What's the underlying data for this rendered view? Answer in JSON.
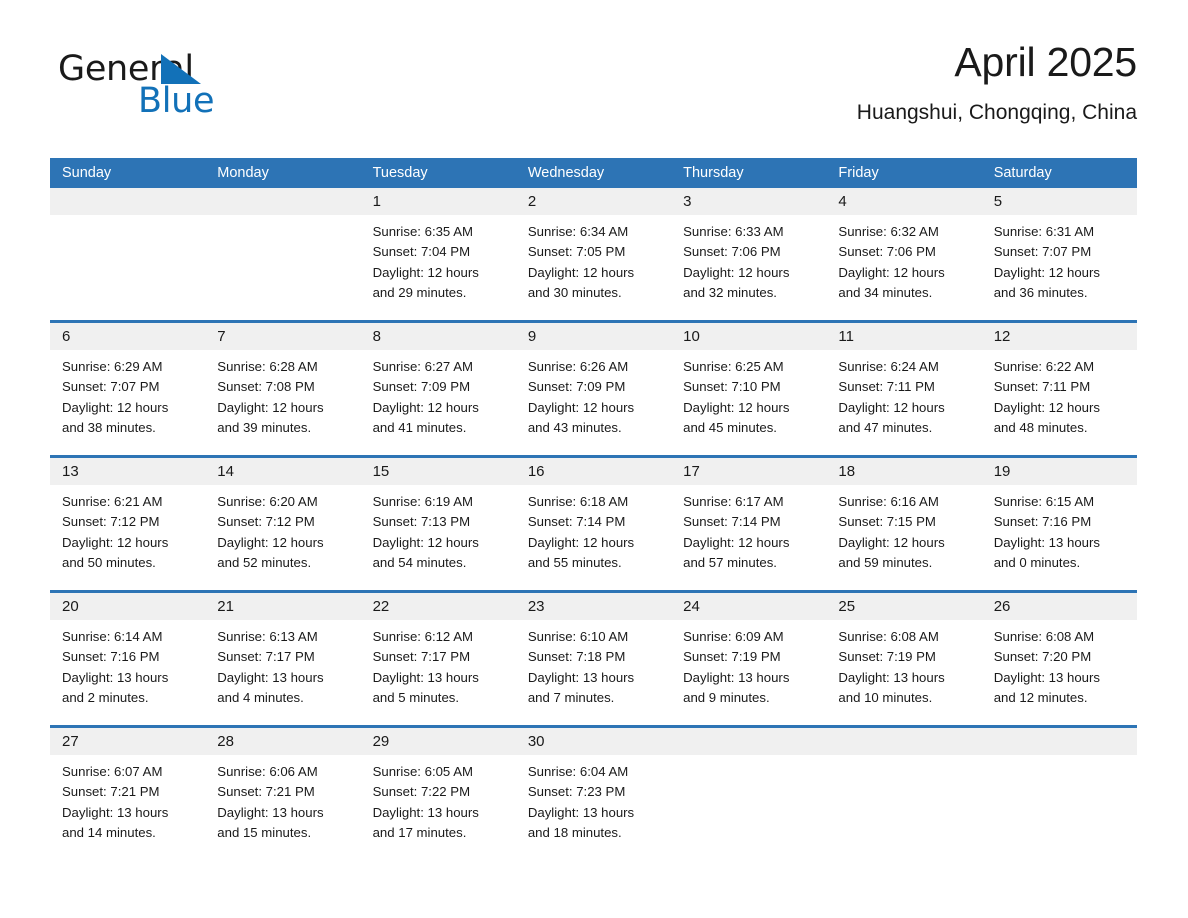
{
  "brand": {
    "name_part1": "General",
    "name_part2": "Blue",
    "triangle_icon": "blue-triangle-icon",
    "colors": {
      "black": "#1a1a1a",
      "blue": "#1271b8"
    }
  },
  "header": {
    "month_title": "April 2025",
    "location": "Huangshui, Chongqing, China"
  },
  "calendar": {
    "accent_color": "#2d74b5",
    "day_band_color": "#f0f0f0",
    "weekdays": [
      "Sunday",
      "Monday",
      "Tuesday",
      "Wednesday",
      "Thursday",
      "Friday",
      "Saturday"
    ],
    "weeks": [
      [
        {
          "day": "",
          "lines": []
        },
        {
          "day": "",
          "lines": []
        },
        {
          "day": "1",
          "lines": [
            "Sunrise: 6:35 AM",
            "Sunset: 7:04 PM",
            "Daylight: 12 hours",
            "and 29 minutes."
          ]
        },
        {
          "day": "2",
          "lines": [
            "Sunrise: 6:34 AM",
            "Sunset: 7:05 PM",
            "Daylight: 12 hours",
            "and 30 minutes."
          ]
        },
        {
          "day": "3",
          "lines": [
            "Sunrise: 6:33 AM",
            "Sunset: 7:06 PM",
            "Daylight: 12 hours",
            "and 32 minutes."
          ]
        },
        {
          "day": "4",
          "lines": [
            "Sunrise: 6:32 AM",
            "Sunset: 7:06 PM",
            "Daylight: 12 hours",
            "and 34 minutes."
          ]
        },
        {
          "day": "5",
          "lines": [
            "Sunrise: 6:31 AM",
            "Sunset: 7:07 PM",
            "Daylight: 12 hours",
            "and 36 minutes."
          ]
        }
      ],
      [
        {
          "day": "6",
          "lines": [
            "Sunrise: 6:29 AM",
            "Sunset: 7:07 PM",
            "Daylight: 12 hours",
            "and 38 minutes."
          ]
        },
        {
          "day": "7",
          "lines": [
            "Sunrise: 6:28 AM",
            "Sunset: 7:08 PM",
            "Daylight: 12 hours",
            "and 39 minutes."
          ]
        },
        {
          "day": "8",
          "lines": [
            "Sunrise: 6:27 AM",
            "Sunset: 7:09 PM",
            "Daylight: 12 hours",
            "and 41 minutes."
          ]
        },
        {
          "day": "9",
          "lines": [
            "Sunrise: 6:26 AM",
            "Sunset: 7:09 PM",
            "Daylight: 12 hours",
            "and 43 minutes."
          ]
        },
        {
          "day": "10",
          "lines": [
            "Sunrise: 6:25 AM",
            "Sunset: 7:10 PM",
            "Daylight: 12 hours",
            "and 45 minutes."
          ]
        },
        {
          "day": "11",
          "lines": [
            "Sunrise: 6:24 AM",
            "Sunset: 7:11 PM",
            "Daylight: 12 hours",
            "and 47 minutes."
          ]
        },
        {
          "day": "12",
          "lines": [
            "Sunrise: 6:22 AM",
            "Sunset: 7:11 PM",
            "Daylight: 12 hours",
            "and 48 minutes."
          ]
        }
      ],
      [
        {
          "day": "13",
          "lines": [
            "Sunrise: 6:21 AM",
            "Sunset: 7:12 PM",
            "Daylight: 12 hours",
            "and 50 minutes."
          ]
        },
        {
          "day": "14",
          "lines": [
            "Sunrise: 6:20 AM",
            "Sunset: 7:12 PM",
            "Daylight: 12 hours",
            "and 52 minutes."
          ]
        },
        {
          "day": "15",
          "lines": [
            "Sunrise: 6:19 AM",
            "Sunset: 7:13 PM",
            "Daylight: 12 hours",
            "and 54 minutes."
          ]
        },
        {
          "day": "16",
          "lines": [
            "Sunrise: 6:18 AM",
            "Sunset: 7:14 PM",
            "Daylight: 12 hours",
            "and 55 minutes."
          ]
        },
        {
          "day": "17",
          "lines": [
            "Sunrise: 6:17 AM",
            "Sunset: 7:14 PM",
            "Daylight: 12 hours",
            "and 57 minutes."
          ]
        },
        {
          "day": "18",
          "lines": [
            "Sunrise: 6:16 AM",
            "Sunset: 7:15 PM",
            "Daylight: 12 hours",
            "and 59 minutes."
          ]
        },
        {
          "day": "19",
          "lines": [
            "Sunrise: 6:15 AM",
            "Sunset: 7:16 PM",
            "Daylight: 13 hours",
            "and 0 minutes."
          ]
        }
      ],
      [
        {
          "day": "20",
          "lines": [
            "Sunrise: 6:14 AM",
            "Sunset: 7:16 PM",
            "Daylight: 13 hours",
            "and 2 minutes."
          ]
        },
        {
          "day": "21",
          "lines": [
            "Sunrise: 6:13 AM",
            "Sunset: 7:17 PM",
            "Daylight: 13 hours",
            "and 4 minutes."
          ]
        },
        {
          "day": "22",
          "lines": [
            "Sunrise: 6:12 AM",
            "Sunset: 7:17 PM",
            "Daylight: 13 hours",
            "and 5 minutes."
          ]
        },
        {
          "day": "23",
          "lines": [
            "Sunrise: 6:10 AM",
            "Sunset: 7:18 PM",
            "Daylight: 13 hours",
            "and 7 minutes."
          ]
        },
        {
          "day": "24",
          "lines": [
            "Sunrise: 6:09 AM",
            "Sunset: 7:19 PM",
            "Daylight: 13 hours",
            "and 9 minutes."
          ]
        },
        {
          "day": "25",
          "lines": [
            "Sunrise: 6:08 AM",
            "Sunset: 7:19 PM",
            "Daylight: 13 hours",
            "and 10 minutes."
          ]
        },
        {
          "day": "26",
          "lines": [
            "Sunrise: 6:08 AM",
            "Sunset: 7:20 PM",
            "Daylight: 13 hours",
            "and 12 minutes."
          ]
        }
      ],
      [
        {
          "day": "27",
          "lines": [
            "Sunrise: 6:07 AM",
            "Sunset: 7:21 PM",
            "Daylight: 13 hours",
            "and 14 minutes."
          ]
        },
        {
          "day": "28",
          "lines": [
            "Sunrise: 6:06 AM",
            "Sunset: 7:21 PM",
            "Daylight: 13 hours",
            "and 15 minutes."
          ]
        },
        {
          "day": "29",
          "lines": [
            "Sunrise: 6:05 AM",
            "Sunset: 7:22 PM",
            "Daylight: 13 hours",
            "and 17 minutes."
          ]
        },
        {
          "day": "30",
          "lines": [
            "Sunrise: 6:04 AM",
            "Sunset: 7:23 PM",
            "Daylight: 13 hours",
            "and 18 minutes."
          ]
        },
        {
          "day": "",
          "lines": []
        },
        {
          "day": "",
          "lines": []
        },
        {
          "day": "",
          "lines": []
        }
      ]
    ]
  }
}
